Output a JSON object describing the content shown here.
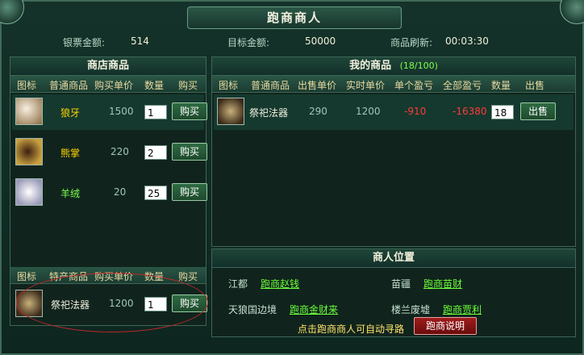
{
  "window": {
    "title": "跑商商人"
  },
  "stats": {
    "silver_label": "银票金额:",
    "silver_value": "514",
    "target_label": "目标金额:",
    "target_value": "50000",
    "refresh_label": "商品刷新:",
    "refresh_value": "00:03:30"
  },
  "shop": {
    "title": "商店商品",
    "headers": [
      "图标",
      "普通商品",
      "购买单价",
      "数量",
      "购买"
    ],
    "items": [
      {
        "name": "狼牙",
        "price": "1500",
        "qty": "1",
        "button": "购买",
        "icon": "wolf-tooth-icon",
        "color": "#ffd400"
      },
      {
        "name": "熊掌",
        "price": "220",
        "qty": "2",
        "button": "购买",
        "icon": "bear-paw-icon",
        "color": "#ffd400"
      },
      {
        "name": "羊绒",
        "price": "20",
        "qty": "25",
        "button": "购买",
        "icon": "cashmere-icon",
        "color": "#7cff4a"
      }
    ],
    "special_headers": [
      "图标",
      "特产商品",
      "购买单价",
      "数量",
      "购买"
    ],
    "special_items": [
      {
        "name": "祭祀法器",
        "price": "1200",
        "qty": "1",
        "button": "购买",
        "icon": "ritual-artifact-icon"
      }
    ]
  },
  "mine": {
    "title": "我的商品",
    "count": "(18/100)",
    "headers": [
      "图标",
      "普通商品",
      "出售单价",
      "实时单价",
      "单个盈亏",
      "全部盈亏",
      "数量",
      "出售"
    ],
    "items": [
      {
        "name": "祭祀法器",
        "sell_price": "290",
        "live_price": "1200",
        "unit_pl": "-910",
        "total_pl": "-16380",
        "qty": "18",
        "button": "出售",
        "icon": "ritual-artifact-icon"
      }
    ]
  },
  "location": {
    "title": "商人位置",
    "entries": [
      {
        "place": "江都",
        "merchant": "跑商赵钱"
      },
      {
        "place": "苗疆",
        "merchant": "跑商苗财"
      },
      {
        "place": "天狼国边境",
        "merchant": "跑商金财来"
      },
      {
        "place": "楼兰废墟",
        "merchant": "跑商贾利"
      }
    ],
    "hint": "点击跑商商人可自动寻路",
    "help_button": "跑商说明"
  },
  "colors": {
    "accent_gold": "#ffd400",
    "link_green": "#6cff3a",
    "loss_red": "#ff3a3a",
    "highlight_ellipse": "#c0282a"
  }
}
